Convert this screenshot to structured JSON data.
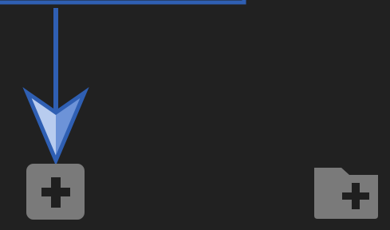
{
  "colors": {
    "background": "#212121",
    "connector": "#2f5fb3",
    "arrow_fill_light": "#b8ccef",
    "arrow_fill_dark": "#6d93d8",
    "button_fill": "#7a7a7a",
    "icon_glyph": "#1f1f1f"
  },
  "controls": {
    "add_item_icon": "plus-square-icon",
    "add_folder_icon": "folder-plus-icon"
  }
}
